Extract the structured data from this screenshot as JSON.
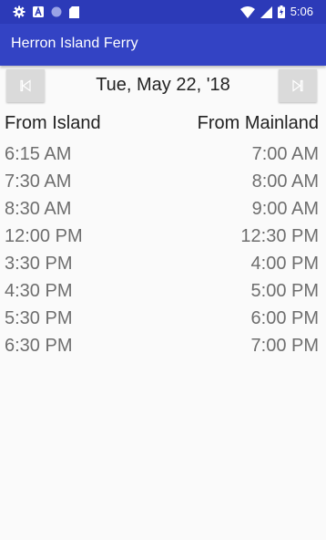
{
  "status_bar": {
    "time": "5:06",
    "left_icons": [
      "settings-icon",
      "a-icon",
      "circle-icon",
      "sd-card-icon"
    ],
    "right_icons": [
      "wifi-icon",
      "signal-icon",
      "battery-charging-icon"
    ]
  },
  "app_bar": {
    "title": "Herron Island Ferry",
    "color": "#3343c4"
  },
  "date_nav": {
    "prev_icon": "skip-previous-icon",
    "next_icon": "skip-next-icon",
    "date": "Tue, May 22, '18"
  },
  "schedule": {
    "from_island_label": "From Island",
    "from_mainland_label": "From Mainland",
    "rows": [
      {
        "island": "6:15 AM",
        "mainland": "7:00 AM"
      },
      {
        "island": "7:30 AM",
        "mainland": "8:00 AM"
      },
      {
        "island": "8:30 AM",
        "mainland": "9:00 AM"
      },
      {
        "island": "12:00 PM",
        "mainland": "12:30 PM"
      },
      {
        "island": "3:30 PM",
        "mainland": "4:00 PM"
      },
      {
        "island": "4:30 PM",
        "mainland": "5:00 PM"
      },
      {
        "island": "5:30 PM",
        "mainland": "6:00 PM"
      },
      {
        "island": "6:30 PM",
        "mainland": "7:00 PM"
      }
    ]
  }
}
